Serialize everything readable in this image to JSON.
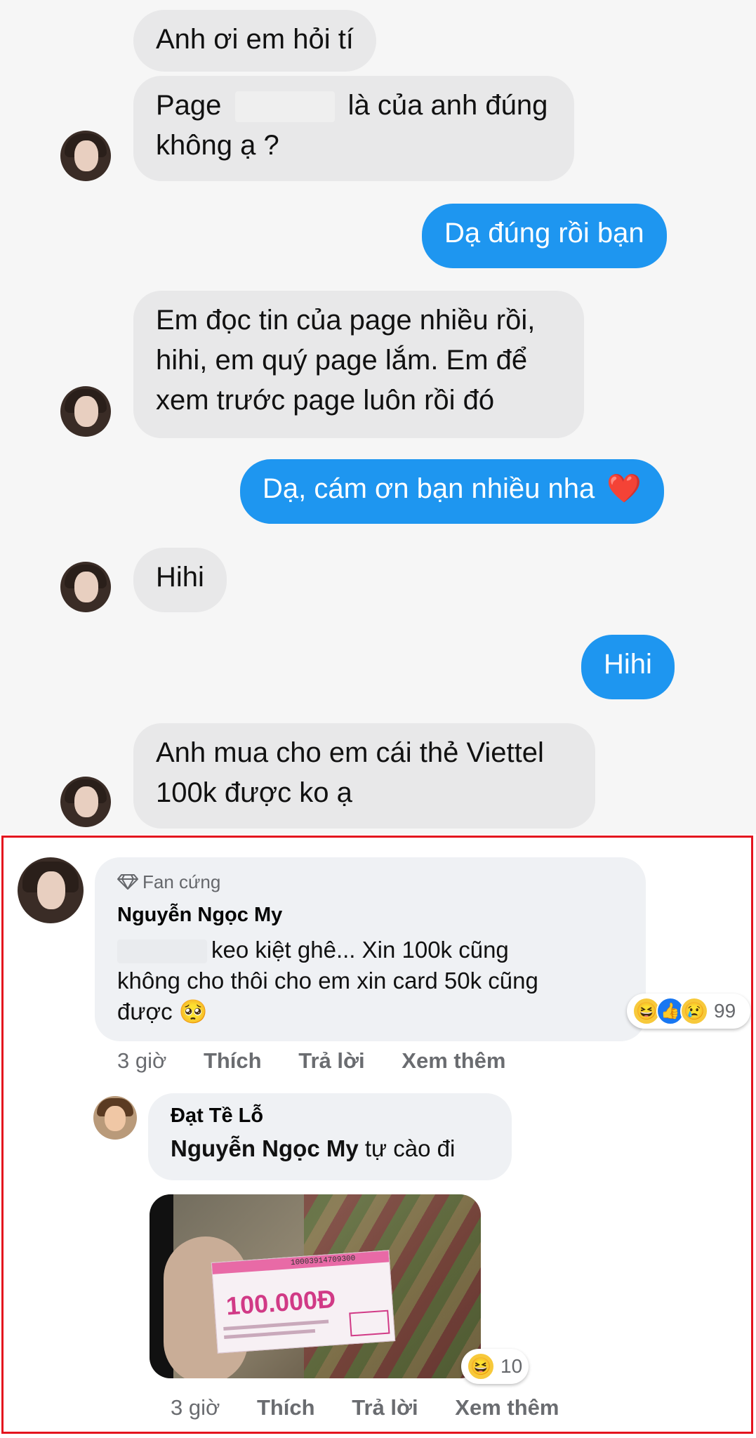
{
  "chat": {
    "messages": [
      {
        "from": "them",
        "lines": [
          "Anh ơi em hỏi tí"
        ]
      },
      {
        "from": "them",
        "line1_before": "Page",
        "line1_after": "là của anh đúng",
        "line2": "không ạ ?"
      },
      {
        "from": "me",
        "text": "Dạ đúng rồi bạn"
      },
      {
        "from": "them",
        "lines": [
          "Em đọc tin của page nhiều rồi,",
          "hihi, em quý page lắm. Em để",
          "xem trước page luôn rồi đó"
        ]
      },
      {
        "from": "me",
        "text": "Dạ, cám ơn bạn nhiều nha",
        "emoji": "❤️"
      },
      {
        "from": "them",
        "lines": [
          "Hihi"
        ]
      },
      {
        "from": "me",
        "text": "Hihi"
      },
      {
        "from": "them",
        "lines": [
          "Anh mua cho em cái thẻ Viettel",
          "100k được ko ạ"
        ]
      }
    ]
  },
  "comment": {
    "badge": "Fan cứng",
    "author": "Nguyễn Ngọc My",
    "line1": "keo kiệt ghê... Xin 100k cũng",
    "line2": "không cho thôi cho em xin card 50k cũng",
    "line3": "được",
    "emoji": "🥺",
    "reactions": {
      "count": "99",
      "icons": [
        "haha-icon",
        "like-icon",
        "sad-icon"
      ]
    },
    "actions": {
      "time": "3 giờ",
      "like": "Thích",
      "reply": "Trả lời",
      "more": "Xem thêm"
    }
  },
  "reply": {
    "author": "Đạt Tề Lỗ",
    "mention": "Nguyễn Ngọc My",
    "text": "tự cào đi",
    "photo": {
      "card_value": "100.000Đ",
      "serial": "10003914709300"
    },
    "reactions": {
      "count": "10"
    },
    "actions": {
      "time": "3 giờ",
      "like": "Thích",
      "reply": "Trả lời",
      "more": "Xem thêm"
    }
  },
  "colors": {
    "outgoing": "#1e96f0",
    "incoming": "#e8e8e9",
    "highlight_border": "#e4141e"
  }
}
